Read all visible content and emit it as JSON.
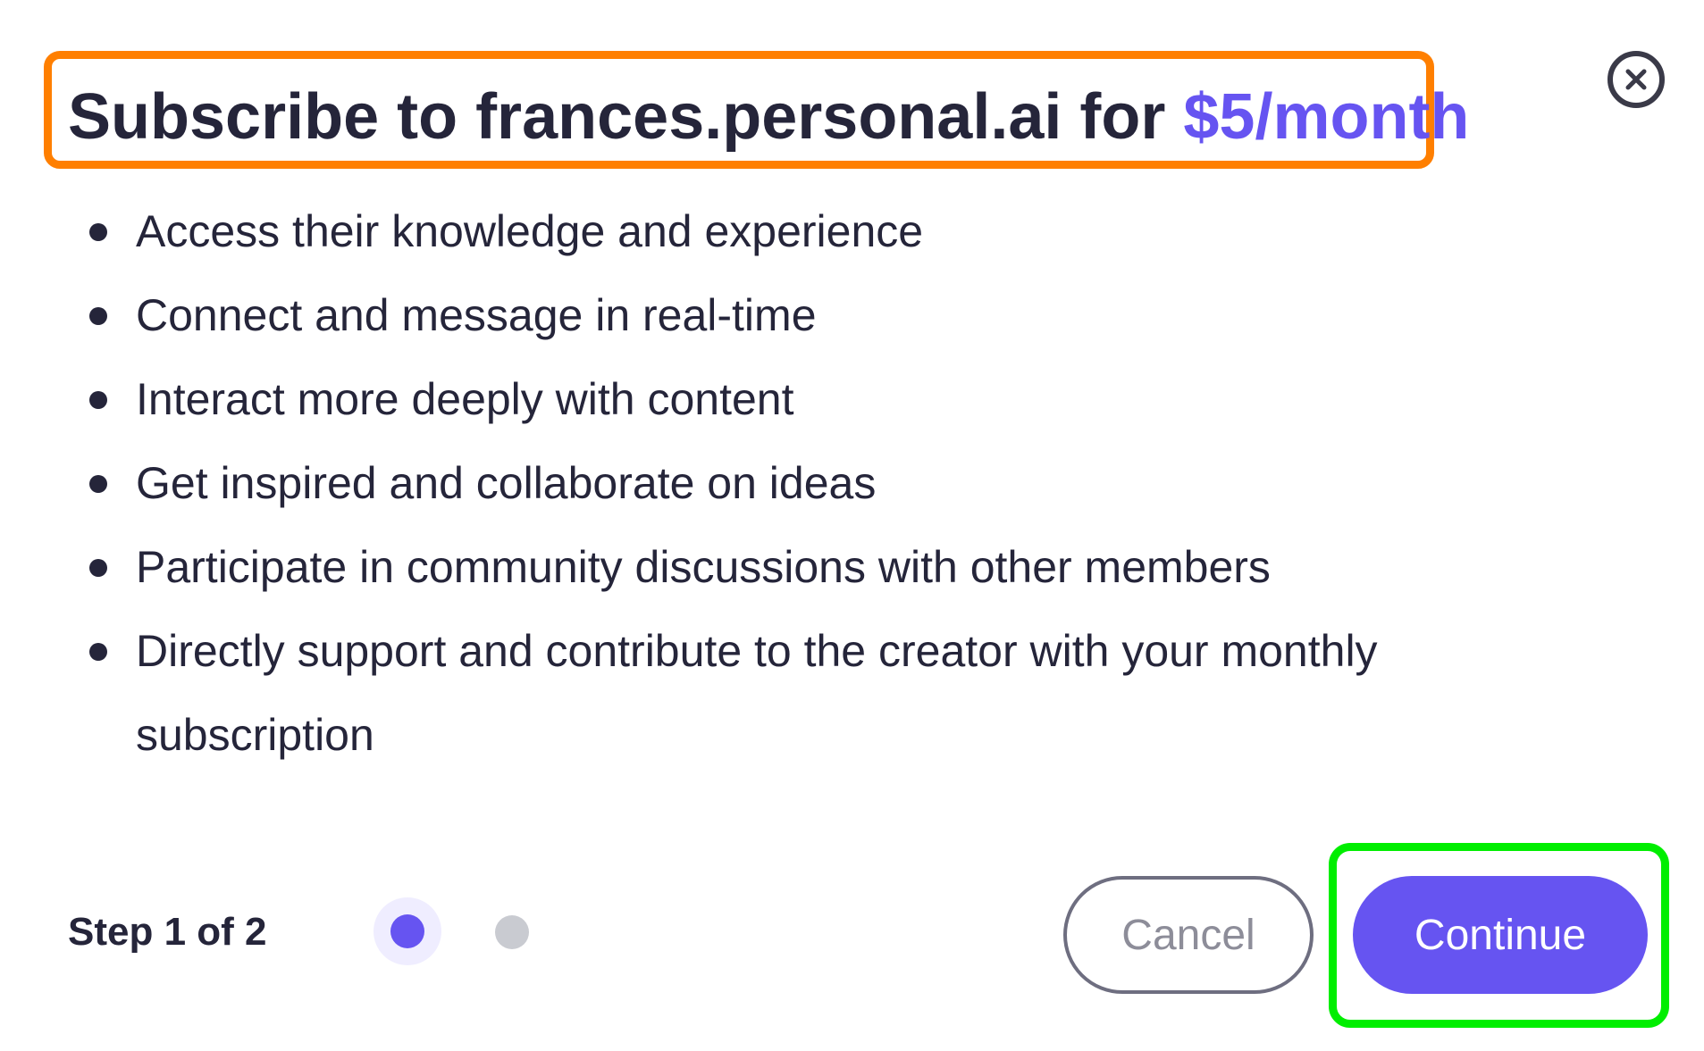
{
  "dialog": {
    "title_prefix": "Subscribe to frances.personal.ai for ",
    "title_price": "$5/month",
    "close_icon": "close-circle-icon"
  },
  "benefits": [
    "Access their knowledge and experience",
    "Connect and message in real-time",
    "Interact more deeply with content",
    "Get inspired and collaborate on ideas",
    "Participate in community discussions with other members",
    "Directly support and contribute to the creator with your monthly subscription"
  ],
  "footer": {
    "step_label": "Step 1 of 2",
    "steps_total": 2,
    "current_step": 1,
    "cancel_label": "Cancel",
    "continue_label": "Continue"
  },
  "colors": {
    "accent": "#6654f1",
    "text": "#25253a",
    "title_highlight": "#ff7f00",
    "continue_highlight": "#00ee00",
    "inactive_dot": "#c9cbd1"
  }
}
